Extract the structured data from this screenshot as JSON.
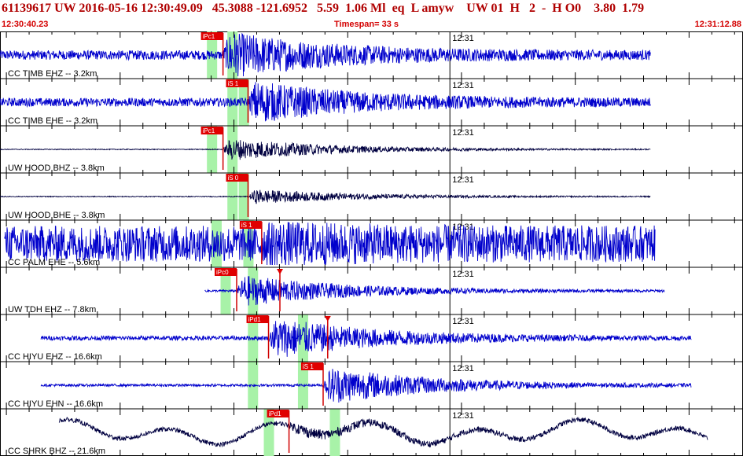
{
  "header": {
    "event_line": "61139617 UW 2016-05-16 12:30:49.09   45.3088 -121.6952   5.59  1.06 Ml  eq  L amyw    UW 01  H   2  -  H O0    3.80  1.79",
    "start_time": "12:30:40.23",
    "timespan": "Timespan=  33 s",
    "end_time": "12:31:12.88"
  },
  "chart_data": {
    "type": "line",
    "title": "61139617 UW 2016-05-16 12:30:49.09",
    "x_axis": {
      "start": 0,
      "end": 32.65,
      "unit": "s",
      "minute_label": "12:31"
    },
    "channels": [
      {
        "label": "CC TIMB EHZ -- 3.2km",
        "color": "#0000cc",
        "start": 0.0,
        "end": 28.6,
        "amp": 0.22,
        "burst": 1.0,
        "picks": [
          {
            "label": "iPc1",
            "t": 9.8
          }
        ],
        "windows": [
          9.3,
          10.2
        ]
      },
      {
        "label": "CC TIMB EHE -- 3.2km",
        "color": "#0000cc",
        "start": 0.0,
        "end": 28.6,
        "amp": 0.2,
        "burst": 0.9,
        "picks": [
          {
            "label": "iS 1",
            "t": 10.9
          }
        ],
        "windows": [
          10.2,
          10.7
        ]
      },
      {
        "label": "UW HOOD BHZ -- 3.8km",
        "color": "#000040",
        "start": 0.0,
        "end": 28.6,
        "amp": 0.02,
        "burst": 0.55,
        "picks": [
          {
            "label": "iPc1",
            "t": 9.8
          }
        ],
        "windows": [
          9.3,
          10.2
        ]
      },
      {
        "label": "UW HOOD BHE -- 3.8km",
        "color": "#000040",
        "start": 0.0,
        "end": 28.6,
        "amp": 0.02,
        "burst": 0.35,
        "picks": [
          {
            "label": "iS 0",
            "t": 10.9
          }
        ],
        "windows": [
          10.2,
          10.7
        ]
      },
      {
        "label": "CC PALM EHE -- 5.6km",
        "color": "#0000cc",
        "start": 0.2,
        "end": 28.8,
        "amp": 0.85,
        "burst": 0.3,
        "picks": [
          {
            "label": "iS 1",
            "t": 11.5
          }
        ],
        "windows": [
          9.5,
          10.9
        ]
      },
      {
        "label": "UW TDH EHZ -- 7.8km",
        "color": "#0000cc",
        "start": 9.0,
        "end": 29.2,
        "amp": 0.05,
        "burst": 0.75,
        "picks": [
          {
            "label": "iPc0",
            "t": 10.4
          },
          {
            "label": "",
            "t": 12.3
          }
        ],
        "windows": [
          9.9,
          11.1
        ]
      },
      {
        "label": "CC HIYU EHZ -- 16.6km",
        "color": "#0000cc",
        "start": 1.8,
        "end": 30.4,
        "amp": 0.1,
        "burst": 0.95,
        "picks": [
          {
            "label": "iPd1",
            "t": 11.8
          },
          {
            "label": "",
            "t": 14.4
          }
        ],
        "windows": [
          11.1,
          13.3
        ]
      },
      {
        "label": "CC HIYU EHN -- 16.6km",
        "color": "#0000cc",
        "start": 1.8,
        "end": 30.4,
        "amp": 0.06,
        "burst": 0.9,
        "picks": [
          {
            "label": "iS 1",
            "t": 14.2
          }
        ],
        "windows": [
          11.1,
          13.3
        ]
      },
      {
        "label": "CC SHRK BHZ -- 21.6km",
        "color": "#000040",
        "start": 2.6,
        "end": 31.1,
        "amp": 0.35,
        "burst": 0.6,
        "picks": [
          {
            "label": "iPd1",
            "t": 12.7
          }
        ],
        "windows": [
          11.8,
          14.7
        ]
      }
    ]
  }
}
